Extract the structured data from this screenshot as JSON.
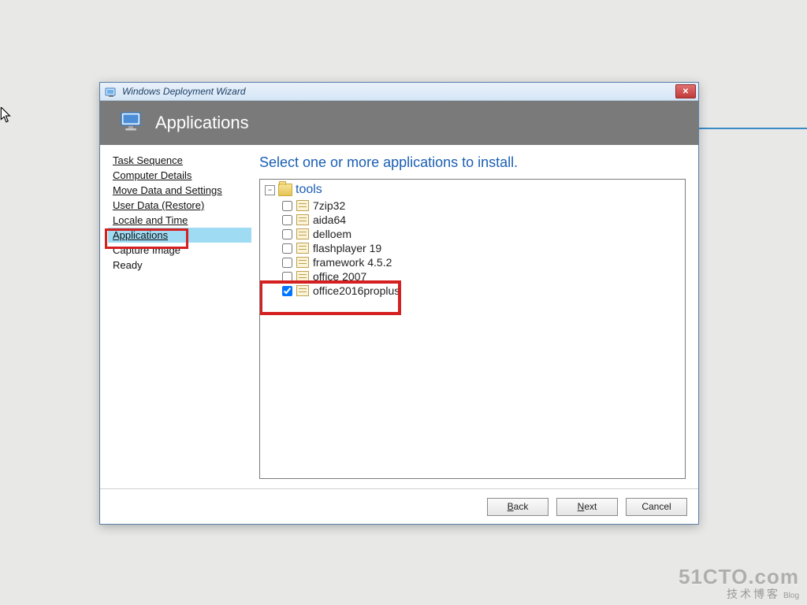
{
  "window": {
    "title": "Windows Deployment Wizard"
  },
  "header": {
    "title": "Applications"
  },
  "sidebar": {
    "items": [
      {
        "label": "Task Sequence",
        "underline": true,
        "active": false
      },
      {
        "label": "Computer Details",
        "underline": true,
        "active": false
      },
      {
        "label": "Move Data and Settings",
        "underline": true,
        "active": false
      },
      {
        "label": "User Data (Restore)",
        "underline": true,
        "active": false
      },
      {
        "label": "Locale and Time",
        "underline": true,
        "active": false
      },
      {
        "label": "Applications",
        "underline": true,
        "active": true
      },
      {
        "label": "Capture Image",
        "underline": false,
        "active": false
      },
      {
        "label": "Ready",
        "underline": false,
        "active": false
      }
    ]
  },
  "main": {
    "heading": "Select one or more applications to install.",
    "tree": {
      "root_label": "tools",
      "items": [
        {
          "label": "7zip32",
          "checked": false
        },
        {
          "label": "aida64",
          "checked": false
        },
        {
          "label": "delloem",
          "checked": false
        },
        {
          "label": "flashplayer 19",
          "checked": false
        },
        {
          "label": "framework 4.5.2",
          "checked": false
        },
        {
          "label": "office 2007",
          "checked": false
        },
        {
          "label": "office2016proplus",
          "checked": true
        }
      ]
    }
  },
  "footer": {
    "back": "Back",
    "next": "Next",
    "cancel": "Cancel"
  },
  "watermark": {
    "line1": "51CTO.com",
    "line2": "技术博客",
    "blog": "Blog"
  }
}
